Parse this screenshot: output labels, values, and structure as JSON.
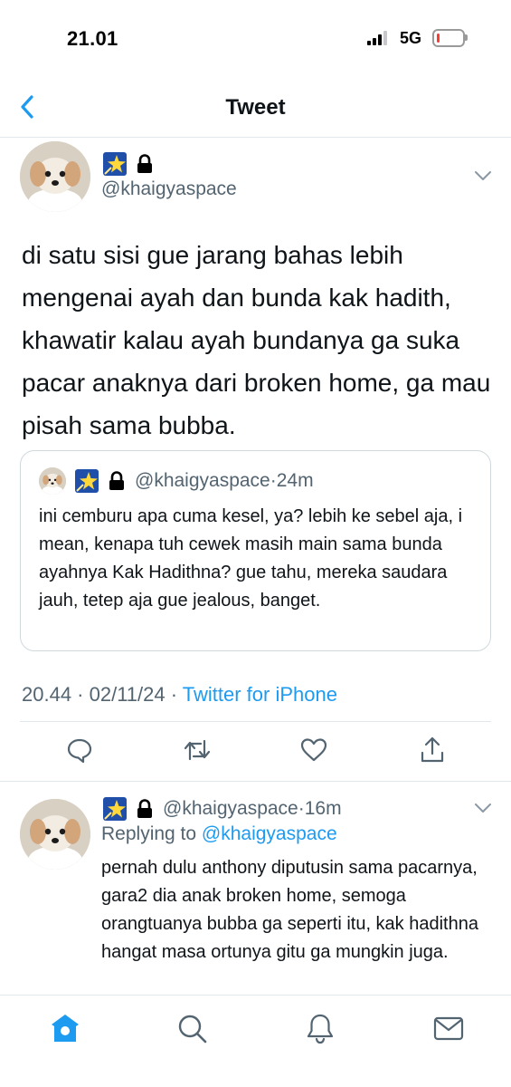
{
  "status_bar": {
    "time": "21.01",
    "network": "5G",
    "battery_level": 0.12
  },
  "header": {
    "title": "Tweet",
    "back_icon": "chevron-left-icon"
  },
  "tweet": {
    "author_handle": "@khaigyaspace",
    "text": "di satu sisi gue jarang bahas lebih mengenai ayah dan bunda kak hadith, khawatir kalau ayah bundanya ga suka pacar anaknya dari broken home, ga mau pisah sama bubba.",
    "quoted": {
      "handle": "@khaigyaspace",
      "time": "24m",
      "text": "ini cemburu apa cuma kesel, ya? lebih ke sebel aja, i mean, kenapa tuh cewek masih main sama bunda ayahnya Kak Hadithna? gue tahu, mereka saudara jauh, tetep aja gue jealous, banget."
    },
    "timestamp": "20.44 · 02/11/24 · ",
    "source": "Twitter for iPhone"
  },
  "actions": [
    "reply-icon",
    "retweet-icon",
    "like-icon",
    "share-icon"
  ],
  "reply": {
    "handle": "@khaigyaspace",
    "time": "16m",
    "replying_label": "Replying to ",
    "replying_to": "@khaigyaspace",
    "text": "pernah dulu anthony diputusin sama pacarnya, gara2 dia anak broken home, semoga orangtuanya bubba ga seperti itu, kak hadithna hangat masa ortunya gitu ga mungkin juga."
  },
  "tabbar": [
    "home-icon",
    "search-icon",
    "notifications-icon",
    "messages-icon"
  ],
  "colors": {
    "accent": "#1d9bf0",
    "text": "#0f1419",
    "secondary": "#536471",
    "border": "#e1e8ed",
    "battery_low": "#ff3b30"
  }
}
